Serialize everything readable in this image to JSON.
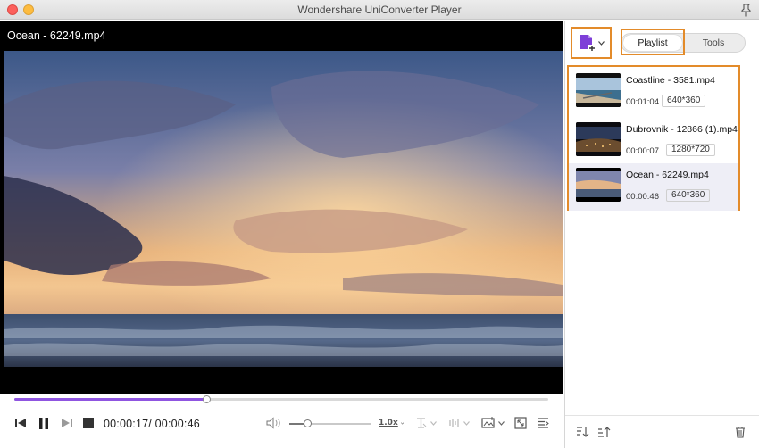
{
  "window": {
    "title": "Wondershare UniConverter Player"
  },
  "player": {
    "file_title": "Ocean - 62249.mp4",
    "progress_fraction": 0.36,
    "volume_fraction": 0.22,
    "current_time": "00:00:17",
    "separator": "/",
    "total_time": "00:00:46",
    "speed_label": "1.0x"
  },
  "panel": {
    "tabs": {
      "playlist": "Playlist",
      "tools": "Tools"
    },
    "playlist": [
      {
        "name": "Coastline - 3581.mp4",
        "duration": "00:01:04",
        "resolution": "640*360",
        "active": false
      },
      {
        "name": "Dubrovnik - 12866 (1).mp4",
        "duration": "00:00:07",
        "resolution": "1280*720",
        "active": false
      },
      {
        "name": "Ocean - 62249.mp4",
        "duration": "00:00:46",
        "resolution": "640*360",
        "active": true
      }
    ]
  },
  "colors": {
    "accent": "#8f55e0",
    "highlight": "#e38b2a"
  }
}
